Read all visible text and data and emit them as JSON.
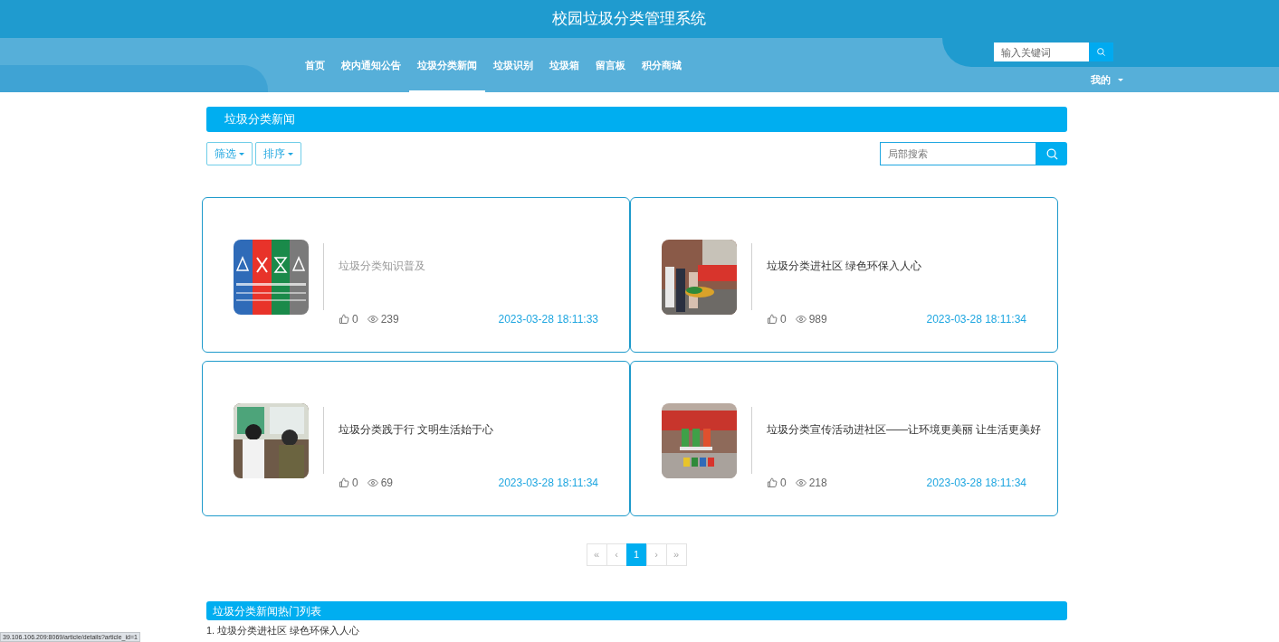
{
  "header": {
    "title": "校园垃圾分类管理系统",
    "nav": [
      {
        "label": "首页",
        "selected": false
      },
      {
        "label": "校内通知公告",
        "selected": false
      },
      {
        "label": "垃圾分类新闻",
        "selected": true
      },
      {
        "label": "垃圾识别",
        "selected": false
      },
      {
        "label": "垃圾箱",
        "selected": false
      },
      {
        "label": "留言板",
        "selected": false
      },
      {
        "label": "积分商城",
        "selected": false
      }
    ],
    "search": {
      "placeholder": "输入关键词"
    },
    "user_menu": "我的"
  },
  "section": {
    "title": "垃圾分类新闻",
    "filter_buttons": [
      "筛选",
      "排序"
    ],
    "search": {
      "placeholder": "局部搜索"
    }
  },
  "articles": [
    {
      "kind": "sign",
      "title": "垃圾分类知识普及",
      "visited": true,
      "likes": "0",
      "views": "239",
      "date": "2023-03-28 18:11:33"
    },
    {
      "kind": "crowd",
      "title": "垃圾分类进社区 绿色环保入人心",
      "visited": false,
      "likes": "0",
      "views": "989",
      "date": "2023-03-28 18:11:34"
    },
    {
      "kind": "board",
      "title": "垃圾分类践于行 文明生活始于心",
      "visited": false,
      "likes": "0",
      "views": "69",
      "date": "2023-03-28 18:11:34"
    },
    {
      "kind": "booth",
      "title": "垃圾分类宣传活动进社区——让环境更美丽 让生活更美好",
      "visited": false,
      "likes": "0",
      "views": "218",
      "date": "2023-03-28 18:11:34"
    }
  ],
  "pagination": [
    {
      "label": "«",
      "selected": false
    },
    {
      "label": "‹",
      "selected": false
    },
    {
      "label": "1",
      "selected": true
    },
    {
      "label": "›",
      "selected": false
    },
    {
      "label": "»",
      "selected": false
    }
  ],
  "hot_list": {
    "title": "垃圾分类新闻热门列表",
    "items": [
      "1. 垃圾分类进社区 绿色环保入人心"
    ]
  },
  "status_url": "39.106.106.209:8069/article/details?article_id=1"
}
